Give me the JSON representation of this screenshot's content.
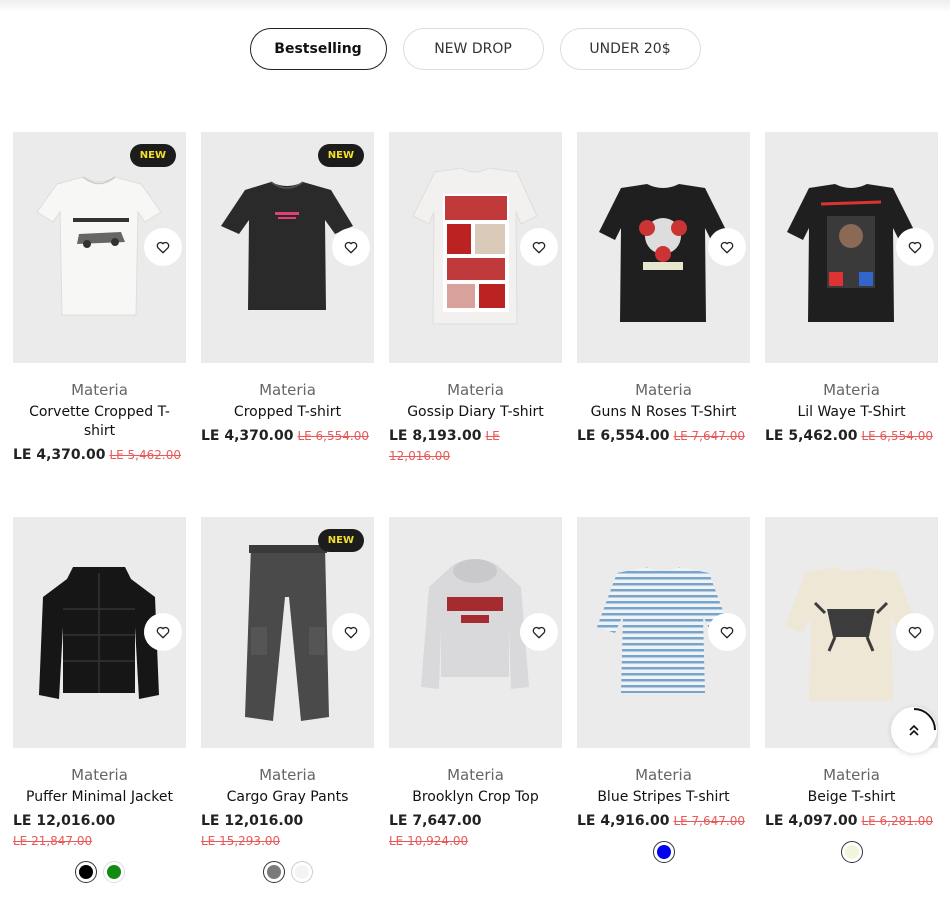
{
  "tabs": [
    {
      "label": "Bestselling",
      "active": true
    },
    {
      "label": "NEW DROP",
      "active": false
    },
    {
      "label": "UNDER 20$",
      "active": false
    }
  ],
  "badge_label": "NEW",
  "products": [
    {
      "brand": "Materia",
      "title": "Corvette Cropped T-shirt",
      "price": "LE 4,370.00",
      "old_price": "LE 5,462.00",
      "badge": true,
      "image": "white-tee"
    },
    {
      "brand": "Materia",
      "title": "Cropped T-shirt",
      "price": "LE 4,370.00",
      "old_price": "LE 6,554.00",
      "badge": true,
      "image": "black-crop-tee"
    },
    {
      "brand": "Materia",
      "title": "Gossip Diary T-shirt",
      "price": "LE 8,193.00",
      "old_price": "LE 12,016.00",
      "badge": false,
      "image": "print-tee"
    },
    {
      "brand": "Materia",
      "title": "Guns N Roses T-Shirt",
      "price": "LE 6,554.00",
      "old_price": "LE 7,647.00",
      "badge": false,
      "image": "black-graphic-tee"
    },
    {
      "brand": "Materia",
      "title": "Lil Waye T-Shirt",
      "price": "LE 5,462.00",
      "old_price": "LE 6,554.00",
      "badge": false,
      "image": "black-rap-tee"
    },
    {
      "brand": "Materia",
      "title": "Puffer Minimal Jacket",
      "price": "LE 12,016.00",
      "old_price": "LE 21,847.00",
      "badge": false,
      "image": "puffer-jacket",
      "swatches": [
        "#000000",
        "#138a13"
      ]
    },
    {
      "brand": "Materia",
      "title": "Cargo Gray Pants",
      "price": "LE 12,016.00",
      "old_price": "LE 15,293.00",
      "badge": true,
      "image": "cargo-pants",
      "swatches": [
        "#7a7a7a",
        "#f4f4f4"
      ]
    },
    {
      "brand": "Materia",
      "title": "Brooklyn Crop Top",
      "price": "LE 7,647.00",
      "old_price": "LE 10,924.00",
      "badge": false,
      "image": "hoodie"
    },
    {
      "brand": "Materia",
      "title": "Blue Stripes T-shirt",
      "price": "LE 4,916.00",
      "old_price": "LE 7,647.00",
      "badge": false,
      "image": "striped-tee",
      "swatches": [
        "#0000ee"
      ]
    },
    {
      "brand": "Materia",
      "title": "Beige T-shirt",
      "price": "LE 4,097.00",
      "old_price": "LE 6,281.00",
      "badge": false,
      "image": "beige-tee",
      "swatches": [
        "#f2f5dc"
      ]
    }
  ],
  "icons": {
    "wishlist": "heart-icon",
    "scroll_top": "double-chevron-up-icon"
  }
}
